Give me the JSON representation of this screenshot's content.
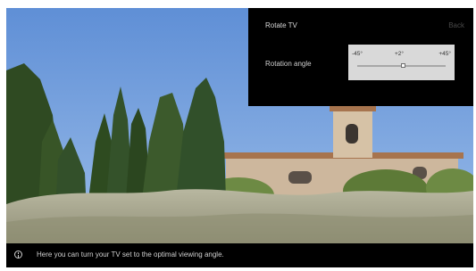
{
  "panel": {
    "title": "Rotate TV",
    "back_label": "Back"
  },
  "rotation": {
    "label": "Rotation angle",
    "min_label": "-45°",
    "current_label": "+2°",
    "max_label": "+45°",
    "min": -45,
    "max": 45,
    "value": 2
  },
  "info": {
    "message": "Here you can turn your TV set to the optimal viewing angle.",
    "icon": "info-icon"
  },
  "colors": {
    "panel_bg": "#000000",
    "slider_bg": "#d9d9d9",
    "sky": "#7aa6df"
  }
}
